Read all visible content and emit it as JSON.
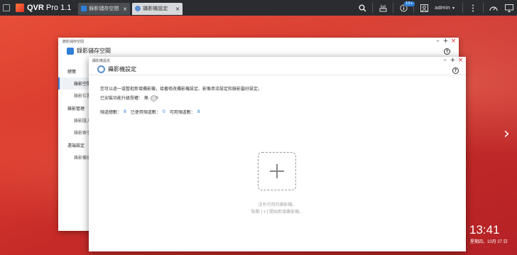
{
  "topbar": {
    "app_title": "QVR",
    "app_title_suffix": "Pro",
    "app_version": "1.1",
    "tabs": [
      {
        "label": "錄影儲存空間",
        "active": false
      },
      {
        "label": "攝影機設定",
        "active": true
      }
    ],
    "notification_badge": "10+",
    "user": "admin",
    "icons": [
      "menu-icon",
      "search-icon",
      "tools-icon",
      "info-icon",
      "user-icon",
      "more-icon",
      "dashboard-icon",
      "monitor-icon"
    ]
  },
  "storage_window": {
    "titlebar_label": "錄影儲存空間",
    "title": "錄影儲存空間",
    "sidebar": [
      {
        "type": "header",
        "label": "總覽"
      },
      {
        "type": "item",
        "label": "錄影空間",
        "active": true
      },
      {
        "type": "item",
        "label": "錄影位置",
        "active": false
      },
      {
        "type": "header",
        "label": "錄影管理"
      },
      {
        "type": "item",
        "label": "錄影匯入",
        "active": false
      },
      {
        "type": "item",
        "label": "錄影索引",
        "active": false
      },
      {
        "type": "header",
        "label": "遠端設定"
      },
      {
        "type": "item",
        "label": "錄影備份",
        "active": false
      }
    ]
  },
  "camera_window": {
    "titlebar_label": "攝影機設定",
    "title": "攝影機設定",
    "intro": "您可以逐一或整批新增攝影機，接著修改攝影機設定、影像串流設定和錄影靈好設定。",
    "upgrade_label": "已安裝功能升級授權：",
    "upgrade_value": "無",
    "stats": {
      "total_label": "頻道總數：",
      "total_value": "8",
      "used_label": "已使用頻道數：",
      "used_value": "0",
      "available_label": "可用頻道數：",
      "available_value": "8"
    },
    "empty_line1": "沒有可用的攝影機。",
    "empty_line2": "點擊 [+] 開始新增攝影機。"
  },
  "desktop": {
    "clock": "13:41",
    "date": "星期四，10月 27 日"
  },
  "colors": {
    "accent": "#2f7fd8",
    "topbar": "#2a2c30",
    "close": "#e03030"
  }
}
